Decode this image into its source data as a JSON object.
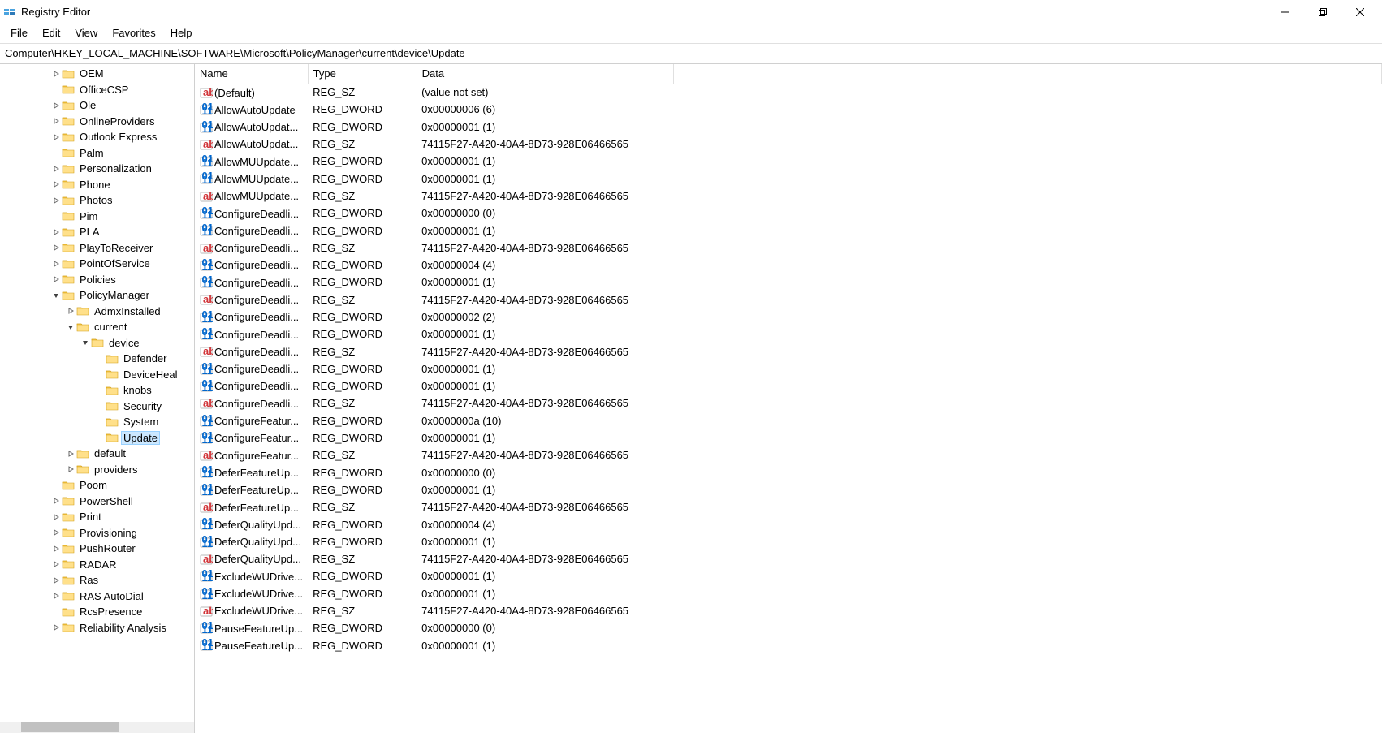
{
  "title": "Registry Editor",
  "menu": [
    "File",
    "Edit",
    "View",
    "Favorites",
    "Help"
  ],
  "address": "Computer\\HKEY_LOCAL_MACHINE\\SOFTWARE\\Microsoft\\PolicyManager\\current\\device\\Update",
  "columns": {
    "name": "Name",
    "type": "Type",
    "data": "Data"
  },
  "tree": [
    {
      "indent": 4,
      "exp": "c",
      "label": "OEM"
    },
    {
      "indent": 4,
      "exp": null,
      "label": "OfficeCSP"
    },
    {
      "indent": 4,
      "exp": "c",
      "label": "Ole"
    },
    {
      "indent": 4,
      "exp": "c",
      "label": "OnlineProviders"
    },
    {
      "indent": 4,
      "exp": "c",
      "label": "Outlook Express"
    },
    {
      "indent": 4,
      "exp": null,
      "label": "Palm"
    },
    {
      "indent": 4,
      "exp": "c",
      "label": "Personalization"
    },
    {
      "indent": 4,
      "exp": "c",
      "label": "Phone"
    },
    {
      "indent": 4,
      "exp": "c",
      "label": "Photos"
    },
    {
      "indent": 4,
      "exp": null,
      "label": "Pim"
    },
    {
      "indent": 4,
      "exp": "c",
      "label": "PLA"
    },
    {
      "indent": 4,
      "exp": "c",
      "label": "PlayToReceiver"
    },
    {
      "indent": 4,
      "exp": "c",
      "label": "PointOfService"
    },
    {
      "indent": 4,
      "exp": "c",
      "label": "Policies"
    },
    {
      "indent": 4,
      "exp": "o",
      "label": "PolicyManager"
    },
    {
      "indent": 5,
      "exp": "c",
      "label": "AdmxInstalled"
    },
    {
      "indent": 5,
      "exp": "o",
      "label": "current"
    },
    {
      "indent": 6,
      "exp": "o",
      "label": "device"
    },
    {
      "indent": 7,
      "exp": null,
      "label": "Defender"
    },
    {
      "indent": 7,
      "exp": null,
      "label": "DeviceHeal"
    },
    {
      "indent": 7,
      "exp": null,
      "label": "knobs"
    },
    {
      "indent": 7,
      "exp": null,
      "label": "Security"
    },
    {
      "indent": 7,
      "exp": null,
      "label": "System"
    },
    {
      "indent": 7,
      "exp": null,
      "label": "Update",
      "selected": true
    },
    {
      "indent": 5,
      "exp": "c",
      "label": "default"
    },
    {
      "indent": 5,
      "exp": "c",
      "label": "providers"
    },
    {
      "indent": 4,
      "exp": null,
      "label": "Poom"
    },
    {
      "indent": 4,
      "exp": "c",
      "label": "PowerShell"
    },
    {
      "indent": 4,
      "exp": "c",
      "label": "Print"
    },
    {
      "indent": 4,
      "exp": "c",
      "label": "Provisioning"
    },
    {
      "indent": 4,
      "exp": "c",
      "label": "PushRouter"
    },
    {
      "indent": 4,
      "exp": "c",
      "label": "RADAR"
    },
    {
      "indent": 4,
      "exp": "c",
      "label": "Ras"
    },
    {
      "indent": 4,
      "exp": "c",
      "label": "RAS AutoDial"
    },
    {
      "indent": 4,
      "exp": null,
      "label": "RcsPresence"
    },
    {
      "indent": 4,
      "exp": "c",
      "label": "Reliability Analysis"
    }
  ],
  "values": [
    {
      "icon": "sz",
      "name": "(Default)",
      "type": "REG_SZ",
      "data": "(value not set)"
    },
    {
      "icon": "dw",
      "name": "AllowAutoUpdate",
      "type": "REG_DWORD",
      "data": "0x00000006 (6)"
    },
    {
      "icon": "dw",
      "name": "AllowAutoUpdat...",
      "type": "REG_DWORD",
      "data": "0x00000001 (1)"
    },
    {
      "icon": "sz",
      "name": "AllowAutoUpdat...",
      "type": "REG_SZ",
      "data": "74115F27-A420-40A4-8D73-928E06466565"
    },
    {
      "icon": "dw",
      "name": "AllowMUUpdate...",
      "type": "REG_DWORD",
      "data": "0x00000001 (1)"
    },
    {
      "icon": "dw",
      "name": "AllowMUUpdate...",
      "type": "REG_DWORD",
      "data": "0x00000001 (1)"
    },
    {
      "icon": "sz",
      "name": "AllowMUUpdate...",
      "type": "REG_SZ",
      "data": "74115F27-A420-40A4-8D73-928E06466565"
    },
    {
      "icon": "dw",
      "name": "ConfigureDeadli...",
      "type": "REG_DWORD",
      "data": "0x00000000 (0)"
    },
    {
      "icon": "dw",
      "name": "ConfigureDeadli...",
      "type": "REG_DWORD",
      "data": "0x00000001 (1)"
    },
    {
      "icon": "sz",
      "name": "ConfigureDeadli...",
      "type": "REG_SZ",
      "data": "74115F27-A420-40A4-8D73-928E06466565"
    },
    {
      "icon": "dw",
      "name": "ConfigureDeadli...",
      "type": "REG_DWORD",
      "data": "0x00000004 (4)"
    },
    {
      "icon": "dw",
      "name": "ConfigureDeadli...",
      "type": "REG_DWORD",
      "data": "0x00000001 (1)"
    },
    {
      "icon": "sz",
      "name": "ConfigureDeadli...",
      "type": "REG_SZ",
      "data": "74115F27-A420-40A4-8D73-928E06466565"
    },
    {
      "icon": "dw",
      "name": "ConfigureDeadli...",
      "type": "REG_DWORD",
      "data": "0x00000002 (2)"
    },
    {
      "icon": "dw",
      "name": "ConfigureDeadli...",
      "type": "REG_DWORD",
      "data": "0x00000001 (1)"
    },
    {
      "icon": "sz",
      "name": "ConfigureDeadli...",
      "type": "REG_SZ",
      "data": "74115F27-A420-40A4-8D73-928E06466565"
    },
    {
      "icon": "dw",
      "name": "ConfigureDeadli...",
      "type": "REG_DWORD",
      "data": "0x00000001 (1)"
    },
    {
      "icon": "dw",
      "name": "ConfigureDeadli...",
      "type": "REG_DWORD",
      "data": "0x00000001 (1)"
    },
    {
      "icon": "sz",
      "name": "ConfigureDeadli...",
      "type": "REG_SZ",
      "data": "74115F27-A420-40A4-8D73-928E06466565"
    },
    {
      "icon": "dw",
      "name": "ConfigureFeatur...",
      "type": "REG_DWORD",
      "data": "0x0000000a (10)"
    },
    {
      "icon": "dw",
      "name": "ConfigureFeatur...",
      "type": "REG_DWORD",
      "data": "0x00000001 (1)"
    },
    {
      "icon": "sz",
      "name": "ConfigureFeatur...",
      "type": "REG_SZ",
      "data": "74115F27-A420-40A4-8D73-928E06466565"
    },
    {
      "icon": "dw",
      "name": "DeferFeatureUp...",
      "type": "REG_DWORD",
      "data": "0x00000000 (0)"
    },
    {
      "icon": "dw",
      "name": "DeferFeatureUp...",
      "type": "REG_DWORD",
      "data": "0x00000001 (1)"
    },
    {
      "icon": "sz",
      "name": "DeferFeatureUp...",
      "type": "REG_SZ",
      "data": "74115F27-A420-40A4-8D73-928E06466565"
    },
    {
      "icon": "dw",
      "name": "DeferQualityUpd...",
      "type": "REG_DWORD",
      "data": "0x00000004 (4)"
    },
    {
      "icon": "dw",
      "name": "DeferQualityUpd...",
      "type": "REG_DWORD",
      "data": "0x00000001 (1)"
    },
    {
      "icon": "sz",
      "name": "DeferQualityUpd...",
      "type": "REG_SZ",
      "data": "74115F27-A420-40A4-8D73-928E06466565"
    },
    {
      "icon": "dw",
      "name": "ExcludeWUDrive...",
      "type": "REG_DWORD",
      "data": "0x00000001 (1)"
    },
    {
      "icon": "dw",
      "name": "ExcludeWUDrive...",
      "type": "REG_DWORD",
      "data": "0x00000001 (1)"
    },
    {
      "icon": "sz",
      "name": "ExcludeWUDrive...",
      "type": "REG_SZ",
      "data": "74115F27-A420-40A4-8D73-928E06466565"
    },
    {
      "icon": "dw",
      "name": "PauseFeatureUp...",
      "type": "REG_DWORD",
      "data": "0x00000000 (0)"
    },
    {
      "icon": "dw",
      "name": "PauseFeatureUp...",
      "type": "REG_DWORD",
      "data": "0x00000001 (1)"
    }
  ]
}
